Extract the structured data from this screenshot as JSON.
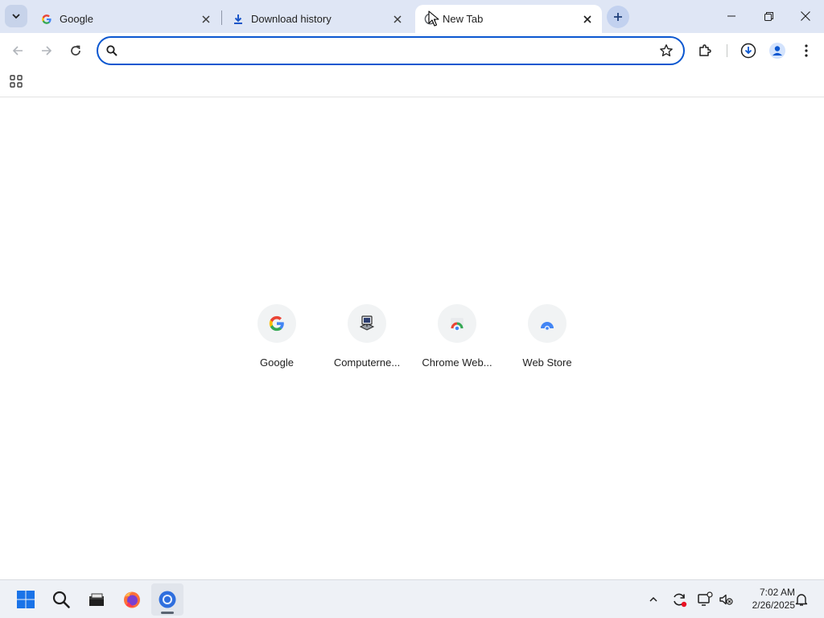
{
  "tabs": [
    {
      "title": "Google",
      "favicon": "google-g-icon"
    },
    {
      "title": "Download history",
      "favicon": "download-icon"
    },
    {
      "title": "New Tab",
      "favicon": "chrome-newtab-icon",
      "active": true
    }
  ],
  "omnibox": {
    "value": "",
    "placeholder": ""
  },
  "shortcuts": [
    {
      "label": "Google",
      "icon": "google-g-icon"
    },
    {
      "label": "Computerne...",
      "icon": "computer-icon"
    },
    {
      "label": "Chrome Web...",
      "icon": "chrome-web-store-icon"
    },
    {
      "label": "Web Store",
      "icon": "web-store-icon"
    }
  ],
  "taskbar": {
    "apps": [
      "windows-start",
      "search",
      "file-explorer",
      "firefox",
      "chrome"
    ],
    "time": "7:02 AM",
    "date": "2/26/2025"
  },
  "colors": {
    "tabstrip_bg": "#dfe6f5",
    "accent": "#0b57d0",
    "active_tab_bg": "#ffffff"
  }
}
